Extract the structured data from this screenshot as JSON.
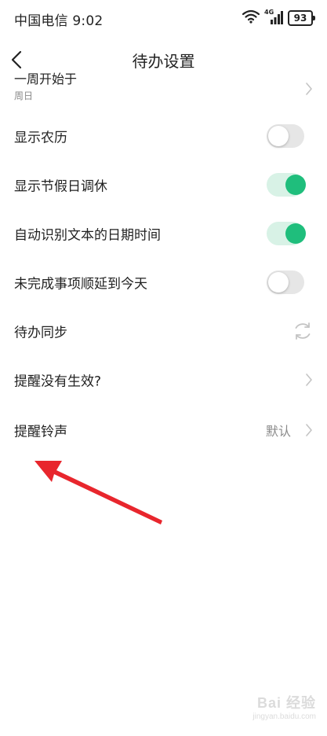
{
  "status_bar": {
    "carrier_time": "中国电信 9:02",
    "network": "4G",
    "battery": "93"
  },
  "header": {
    "title": "待办设置"
  },
  "settings": {
    "week_start": {
      "label": "一周开始于",
      "value": "周日"
    },
    "show_lunar": {
      "label": "显示农历",
      "on": false
    },
    "show_holidays": {
      "label": "显示节假日调休",
      "on": true
    },
    "auto_detect": {
      "label": "自动识别文本的日期时间",
      "on": true
    },
    "postpone": {
      "label": "未完成事项顺延到今天",
      "on": false
    },
    "sync": {
      "label": "待办同步"
    },
    "reminder_help": {
      "label": "提醒没有生效?"
    },
    "ringtone": {
      "label": "提醒铃声",
      "value": "默认"
    }
  },
  "colors": {
    "toggle_on": "#1fbe7c",
    "toggle_on_track": "#d8f2e6",
    "toggle_off_track": "#e6e6e6",
    "annotation_arrow": "#e8262d"
  },
  "watermark": {
    "logo_text": "Bai 经验",
    "url": "jingyan.baidu.com"
  }
}
